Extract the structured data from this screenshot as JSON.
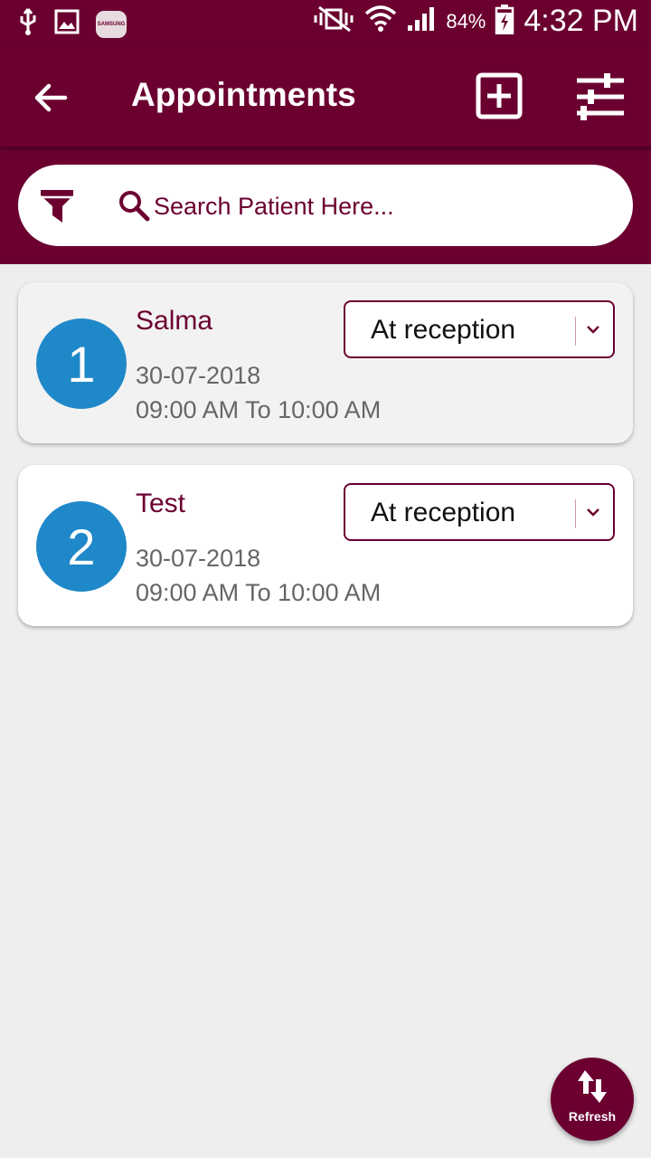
{
  "status_bar": {
    "left_icons": [
      "usb-icon",
      "image-icon",
      "samsung-icon"
    ],
    "samsung_label": "SAMSUNG",
    "right_icons": [
      "vibrate-mute-icon",
      "wifi-icon",
      "signal-icon",
      "battery-charging-icon"
    ],
    "battery": "84%",
    "time": "4:32 PM"
  },
  "app_bar": {
    "title": "Appointments",
    "icons": [
      "back-arrow-icon",
      "add-box-icon",
      "sliders-icon"
    ]
  },
  "search": {
    "placeholder": "Search Patient Here...",
    "value": "",
    "icons": [
      "funnel-icon",
      "search-icon"
    ]
  },
  "appointments": [
    {
      "number": "1",
      "name": "Salma",
      "date": "30-07-2018",
      "time": "09:00 AM To 10:00 AM",
      "status": "At reception"
    },
    {
      "number": "2",
      "name": "Test",
      "date": "30-07-2018",
      "time": "09:00 AM To 10:00 AM",
      "status": "At reception"
    }
  ],
  "fab": {
    "label": "Refresh",
    "icon": "refresh-arrows-icon"
  },
  "colors": {
    "primary": "#6b0030",
    "badge": "#1f88c9",
    "background": "#eeeeee",
    "card": "#ffffff"
  }
}
